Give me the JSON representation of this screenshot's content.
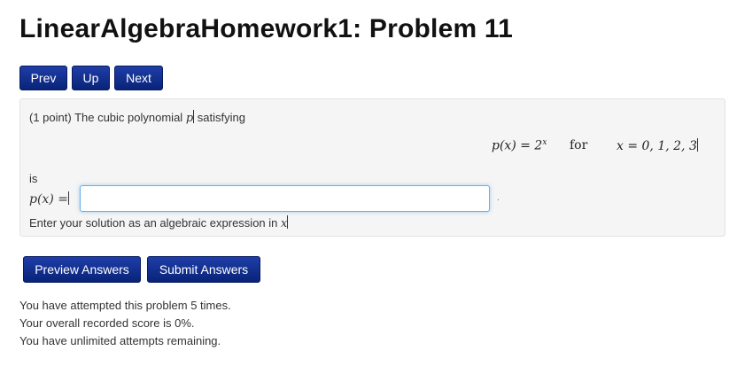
{
  "page_title": "LinearAlgebraHomework1: Problem 11",
  "nav": {
    "prev_label": "Prev",
    "up_label": "Up",
    "next_label": "Next"
  },
  "problem": {
    "points": "(1 point) The cubic polynomial",
    "variable_p": "p",
    "satisfying": "satisfying",
    "equation_left": "p(x) = 2",
    "equation_exponent": "x",
    "equation_for": "for",
    "equation_right": "x = 0, 1, 2, 3",
    "is_text": "is",
    "answer_label": "p(x) =",
    "answer_value": "",
    "trailing": ".",
    "hint_text": "Enter your solution as an algebraic expression in",
    "hint_variable": "x"
  },
  "actions": {
    "preview_label": "Preview Answers",
    "submit_label": "Submit Answers"
  },
  "status": {
    "attempts": "You have attempted this problem 5 times.",
    "score": "Your overall recorded score is 0%.",
    "remaining": "You have unlimited attempts remaining."
  },
  "colors": {
    "button_bg": "#0b2a8a",
    "panel_bg": "#f5f5f5",
    "input_focus": "#66afe9"
  }
}
